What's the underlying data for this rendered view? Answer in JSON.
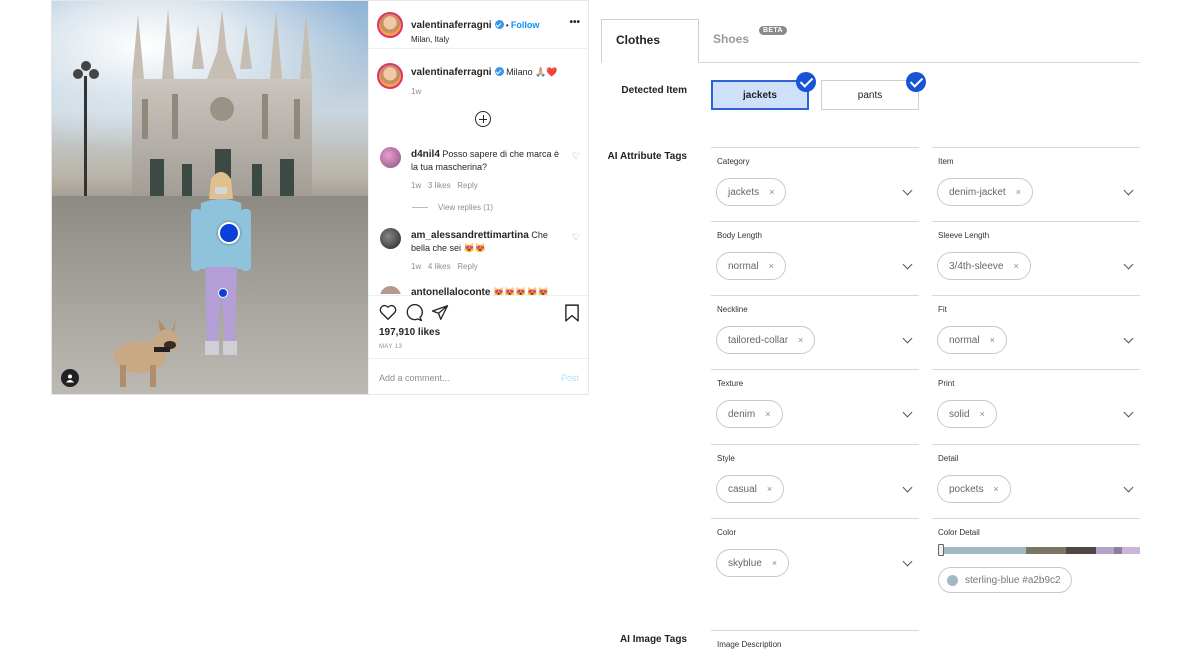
{
  "post": {
    "username": "valentinaferragni",
    "follow_label": "Follow",
    "location": "Milan, Italy",
    "more_label": "•••",
    "caption_text": "Milano 🙏🏼❤️",
    "caption_time": "1w",
    "comments": [
      {
        "user": "d4nil4",
        "text": "Posso sapere di che marca è la tua mascherina?",
        "time": "1w",
        "likes": "3 likes",
        "reply": "Reply",
        "view_replies": "View replies (1)"
      },
      {
        "user": "am_alessandrettimartina",
        "text": "Che bella che sei 😻😻",
        "time": "1w",
        "likes": "4 likes",
        "reply": "Reply"
      },
      {
        "user": "antonellaloconte",
        "text": "😻😻😻😻😻"
      }
    ],
    "likes_count": "197,910 likes",
    "date": "MAY 13",
    "comment_placeholder": "Add a comment...",
    "post_label": "Post"
  },
  "panel": {
    "tabs": [
      {
        "label": "Clothes",
        "active": true
      },
      {
        "label": "Shoes",
        "badge": "BETA"
      }
    ],
    "detected_label": "Detected Item",
    "detected_items": [
      {
        "label": "jackets",
        "active": true
      },
      {
        "label": "pants",
        "active": false
      }
    ],
    "ai_attr_label": "AI Attribute Tags",
    "attributes": [
      {
        "label": "Category",
        "value": "jackets"
      },
      {
        "label": "Item",
        "value": "denim-jacket"
      },
      {
        "label": "Body Length",
        "value": "normal"
      },
      {
        "label": "Sleeve Length",
        "value": "3/4th-sleeve"
      },
      {
        "label": "Neckline",
        "value": "tailored-collar"
      },
      {
        "label": "Fit",
        "value": "normal"
      },
      {
        "label": "Texture",
        "value": "denim"
      },
      {
        "label": "Print",
        "value": "solid"
      },
      {
        "label": "Style",
        "value": "casual"
      },
      {
        "label": "Detail",
        "value": "pockets"
      },
      {
        "label": "Color",
        "value": "skyblue"
      }
    ],
    "color_detail": {
      "label": "Color Detail",
      "swatch_text": "sterling-blue #a2b9c2",
      "swatch_color": "#a2b9c2",
      "bar_colors": [
        "#a2b9c2",
        "#7a7565",
        "#4f4744",
        "#b3a3c9",
        "#8a7f99",
        "#c9b5d9"
      ]
    },
    "ai_image_label": "AI Image Tags",
    "image_description_label": "Image Description",
    "remove_glyph": "×"
  },
  "colors": {
    "accent": "#1852d6",
    "link": "#0095f6",
    "chip_border": "#c8c8c8"
  }
}
